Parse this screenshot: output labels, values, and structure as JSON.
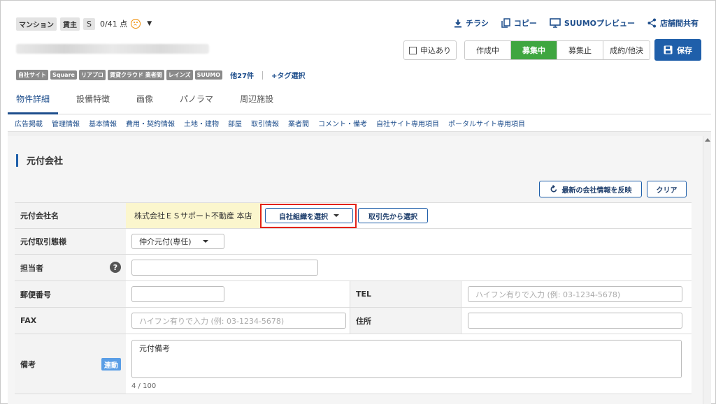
{
  "header": {
    "pills": [
      "マンション",
      "賃主"
    ],
    "size_pill": "S",
    "score": "0/41 点",
    "actions": [
      {
        "label": "チラシ",
        "icon": "download-icon"
      },
      {
        "label": "コピー",
        "icon": "copy-icon"
      },
      {
        "label": "SUUMOプレビュー",
        "icon": "monitor-icon"
      },
      {
        "label": "店舗間共有",
        "icon": "share-icon"
      }
    ]
  },
  "toolbar": {
    "application_label": "申込あり",
    "statuses": [
      "作成中",
      "募集中",
      "募集止",
      "成約/他決"
    ],
    "active_status": "募集中",
    "save_label": "保存"
  },
  "tags": {
    "items": [
      "自社サイト",
      "Square",
      "リアプロ",
      "賃貸クラウド 業者間",
      "レインズ",
      "SUUMO"
    ],
    "more": "他27件",
    "add": "+タグ選択"
  },
  "tabs": [
    "物件詳細",
    "設備特徴",
    "画像",
    "パノラマ",
    "周辺施設"
  ],
  "subnav": [
    "広告掲載",
    "管理情報",
    "基本情報",
    "費用・契約情報",
    "土地・建物",
    "部屋",
    "取引情報",
    "業者間",
    "コメント・備考",
    "自社サイト専用項目",
    "ポータルサイト専用項目"
  ],
  "section": {
    "title": "元付会社",
    "reflect_label": "最新の会社情報を反映",
    "clear_label": "クリア"
  },
  "form": {
    "company_label": "元付会社名",
    "company_value": "株式会社ＥＳサポート不動産 本店",
    "select_org_label": "自社組織を選択",
    "select_partner_label": "取引先から選択",
    "mode_label": "元付取引態様",
    "mode_value": "仲介元付(専任)",
    "person_label": "担当者",
    "postal_label": "郵便番号",
    "tel_label": "TEL",
    "tel_placeholder": "ハイフン有りで入力 (例: 03-1234-5678)",
    "fax_label": "FAX",
    "fax_placeholder": "ハイフン有りで入力 (例: 03-1234-5678)",
    "address_label": "住所",
    "notes_label": "備考",
    "notes_badge": "連動",
    "notes_value": "元付備考",
    "notes_counter": "4 / 100"
  },
  "colors": {
    "brand_blue": "#1f5faa",
    "active_green": "#3fa640",
    "highlight_red": "#e2231a",
    "company_bg": "#fbf6cd"
  }
}
